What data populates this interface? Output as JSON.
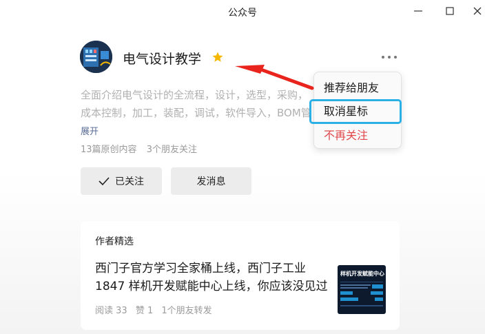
{
  "window": {
    "title": "公众号",
    "controls": [
      "minimize-icon",
      "maximize-icon",
      "close-icon"
    ]
  },
  "profile": {
    "name": "电气设计教学",
    "starred": true,
    "description": "全面介绍电气设计的全流程，设计，选型，采购，成本控制，加工，装配，调试，软件导入，BOM管理，先进的生产机器介绍，拓展，",
    "expand_label": "展开",
    "original_count": "13篇原创内容",
    "friends_following": "3个朋友关注",
    "followed_label": "已关注",
    "message_label": "发消息"
  },
  "menu": {
    "items": [
      {
        "label": "推荐给朋友"
      },
      {
        "label": "取消星标"
      },
      {
        "label": "不再关注"
      }
    ]
  },
  "featured": {
    "title": "作者精选",
    "article": {
      "title": "西门子官方学习全家桶上线，西门子工业1847 样机开发赋能中心上线，你应该没见过的",
      "reads": "阅读 33",
      "likes": "赞 1",
      "shares": "1个朋友转发",
      "thumb_text": "样机开发赋能中心"
    }
  },
  "colors": {
    "star": "#f5b800",
    "danger": "#e0464a",
    "highlight": "#2bb0e6",
    "arrow": "#e8241c",
    "link": "#576b95"
  }
}
